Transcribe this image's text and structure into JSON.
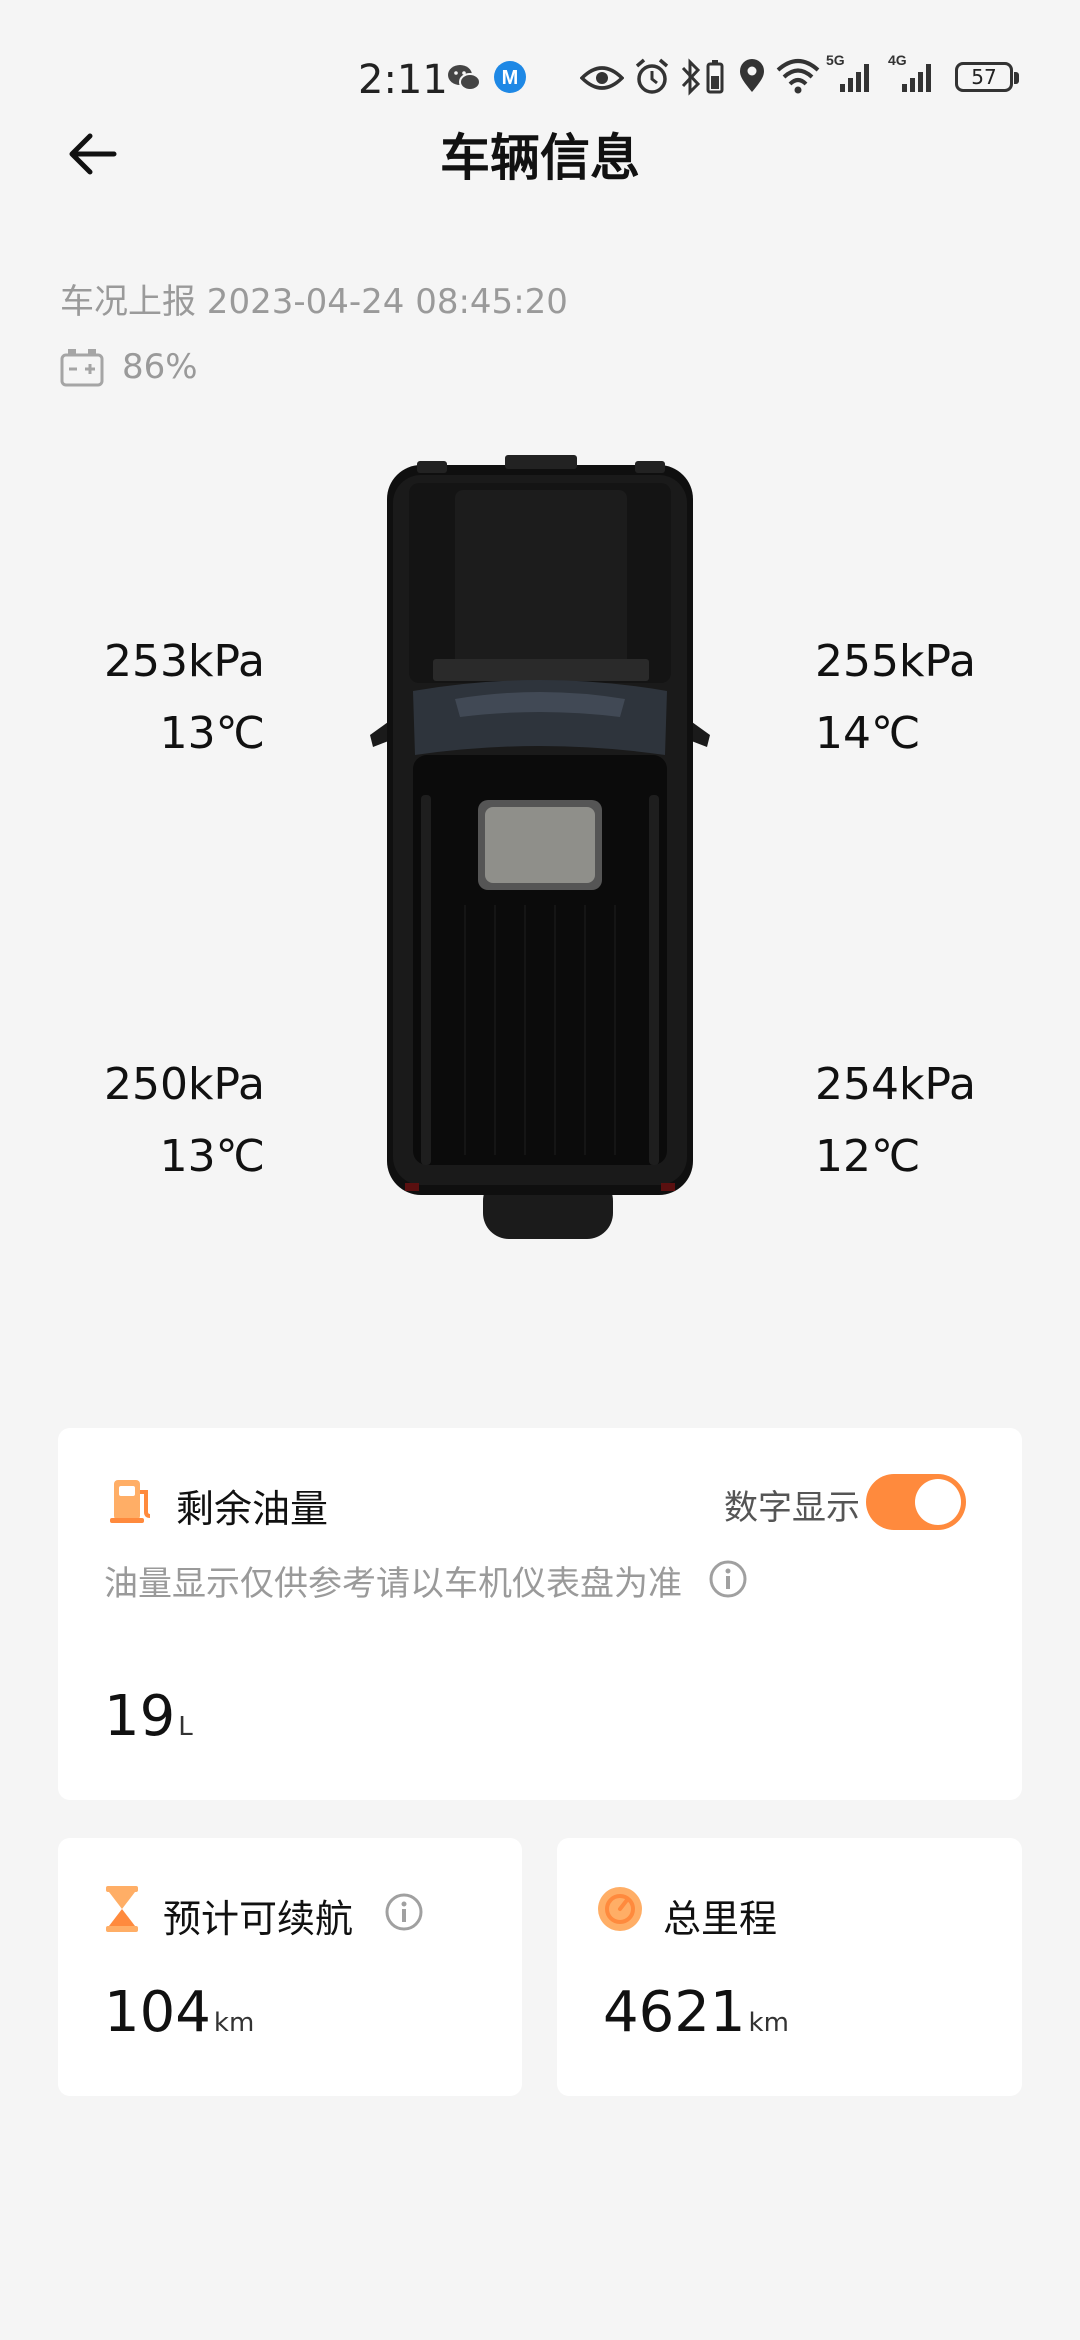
{
  "status_bar": {
    "time": "2:11",
    "battery": "57",
    "icons": [
      "wechat-icon",
      "m-app-icon",
      "eye-icon",
      "alarm-icon",
      "bluetooth-icon",
      "location-icon",
      "wifi-icon",
      "signal-5g-icon",
      "signal-4g-icon"
    ],
    "network_labels": {
      "first": "5G",
      "second": "4G"
    }
  },
  "header": {
    "title": "车辆信息"
  },
  "report": {
    "text": "车况上报 2023-04-24 08:45:20",
    "battery_level": "86%"
  },
  "tires": {
    "front_left": {
      "pressure": "253kPa",
      "temp": "13℃"
    },
    "front_right": {
      "pressure": "255kPa",
      "temp": "14℃"
    },
    "rear_left": {
      "pressure": "250kPa",
      "temp": "13℃"
    },
    "rear_right": {
      "pressure": "254kPa",
      "temp": "12℃"
    }
  },
  "fuel": {
    "label": "剩余油量",
    "toggle_label": "数字显示",
    "toggle_on": true,
    "hint": "油量显示仅供参考请以车机仪表盘为准",
    "value": "19",
    "unit": "L"
  },
  "range": {
    "label": "预计可续航",
    "value": "104",
    "unit": "km"
  },
  "odometer": {
    "label": "总里程",
    "value": "4621",
    "unit": "km"
  },
  "colors": {
    "accent": "#ff8a3d",
    "icon_orange": "#ffae66",
    "muted_text": "#9a9a9a",
    "background": "#f5f5f5"
  }
}
